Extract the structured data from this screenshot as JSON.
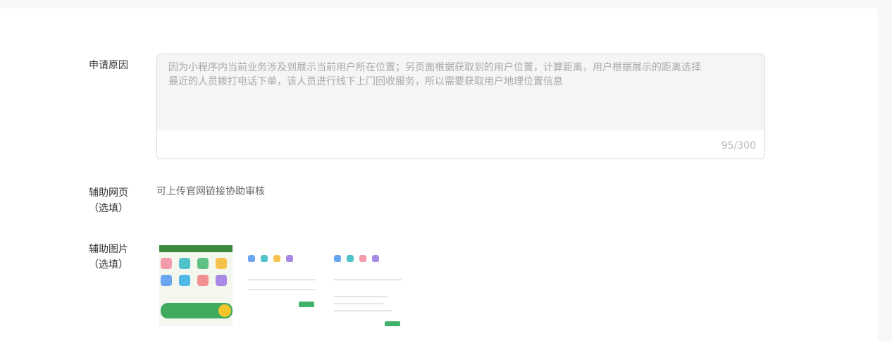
{
  "form": {
    "reason": {
      "label": "申请原因",
      "value": "因为小程序内当前业务涉及到展示当前用户所在位置；另页面根据获取到的用户位置，计算距离，用户根据展示的距离选择最近的人员拨打电话下单，该人员进行线下上门回收服务，所以需要获取用户地理位置信息",
      "counter": "95/300"
    },
    "webpage": {
      "label": "辅助网页",
      "optional": "（选填）",
      "hint": "可上传官网链接协助审核"
    },
    "images": {
      "label": "辅助图片",
      "optional": "（选填）",
      "items": [
        "screenshot-1",
        "screenshot-2",
        "screenshot-3"
      ]
    }
  },
  "colors": {
    "accent_green": "#3fb36b",
    "border": "#dcdcdc",
    "placeholder": "#a8a8a8"
  }
}
